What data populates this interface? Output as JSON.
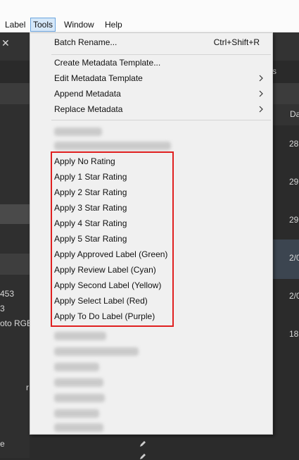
{
  "menubar": {
    "items": [
      "Label",
      "Tools",
      "Window",
      "Help"
    ]
  },
  "background": {
    "right_column_header": "Da",
    "right_column_values": [
      "28",
      "29",
      "29",
      "2/0",
      "2/0",
      "18"
    ],
    "left_values": [
      "453",
      "3",
      "oto RGB"
    ],
    "left_label": "r",
    "bottom_label": "e",
    "breadcrumb_tail": "s"
  },
  "tools_menu": {
    "batch_rename": {
      "label": "Batch Rename...",
      "shortcut": "Ctrl+Shift+R"
    },
    "create_template": "Create Metadata Template...",
    "edit_template": "Edit Metadata Template",
    "append_metadata": "Append Metadata",
    "replace_metadata": "Replace Metadata",
    "rating_items": [
      "Apply No Rating",
      "Apply 1 Star Rating",
      "Apply 2 Star Rating",
      "Apply 3 Star Rating",
      "Apply 4 Star Rating",
      "Apply 5 Star Rating",
      "Apply Approved Label (Green)",
      "Apply Review Label (Cyan)",
      "Apply Second Label (Yellow)",
      "Apply Select Label (Red)",
      "Apply To Do Label (Purple)"
    ],
    "highlight_color": "#e02020"
  }
}
